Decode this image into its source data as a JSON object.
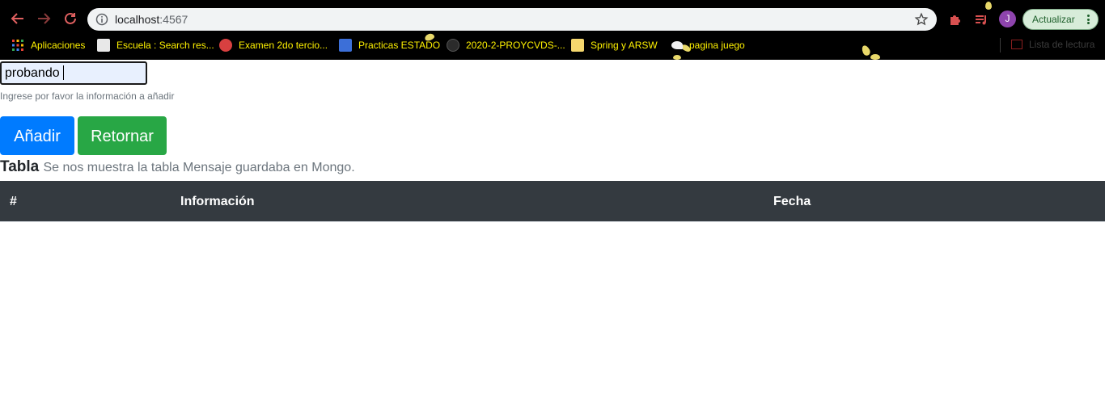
{
  "browser": {
    "url_host": "localhost",
    "url_port": ":4567",
    "profile_initial": "J",
    "update_label": "Actualizar",
    "bookmarks": [
      {
        "label": "Aplicaciones",
        "icon": "apps-grid-icon"
      },
      {
        "label": "Escuela : Search res...",
        "icon": "school-page-icon"
      },
      {
        "label": "Examen 2do tercio...",
        "icon": "globe-red-icon"
      },
      {
        "label": "Practicas ESTADO",
        "icon": "shield-blue-icon"
      },
      {
        "label": "2020-2-PROYCVDS-...",
        "icon": "github-icon"
      },
      {
        "label": "Spring y ARSW",
        "icon": "folder-yellow-icon"
      },
      {
        "label": "pagina juego",
        "icon": "bird-icon"
      }
    ],
    "reading_list_label": "Lista de lectura"
  },
  "form": {
    "input_value": "probando",
    "help_text": "Ingrese por favor la información a añadir",
    "add_label": "Añadir",
    "back_label": "Retornar"
  },
  "table": {
    "caption_title": "Tabla",
    "caption_text": "Se nos muestra la tabla Mensaje guardaba en Mongo.",
    "columns": [
      "#",
      "Información",
      "Fecha"
    ]
  },
  "colors": {
    "primary": "#007bff",
    "success": "#28a745",
    "table_head": "#343a40",
    "bookmark_text": "#fff200"
  }
}
